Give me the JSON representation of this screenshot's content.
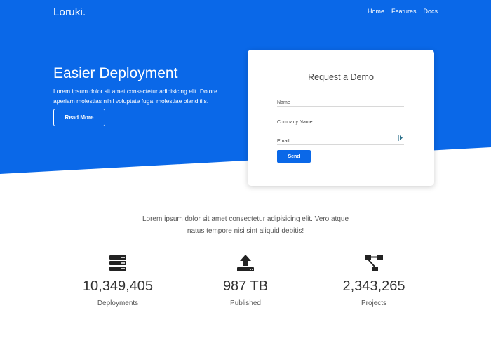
{
  "brand": "Loruki.",
  "nav": [
    "Home",
    "Features",
    "Docs"
  ],
  "hero": {
    "title": "Easier Deployment",
    "text": "Lorem ipsum dolor sit amet consectetur adipisicing elit. Dolore aperiam molestias nihil voluptate fuga, molestiae blanditiis.",
    "button": "Read More"
  },
  "demo_form": {
    "title": "Request a Demo",
    "fields": [
      {
        "placeholder": "Name"
      },
      {
        "placeholder": "Company Name"
      },
      {
        "placeholder": "Email"
      }
    ],
    "submit": "Send"
  },
  "intro": "Lorem ipsum dolor sit amet consectetur adipisicing elit. Vero atque natus tempore nisi sint aliquid debitis!",
  "stats": [
    {
      "icon": "server-icon",
      "value": "10,349,405",
      "label": "Deployments"
    },
    {
      "icon": "upload-icon",
      "value": "987 TB",
      "label": "Published"
    },
    {
      "icon": "project-diagram-icon",
      "value": "2,343,265",
      "label": "Projects"
    }
  ],
  "colors": {
    "primary": "#0a68e8",
    "white": "#ffffff"
  }
}
